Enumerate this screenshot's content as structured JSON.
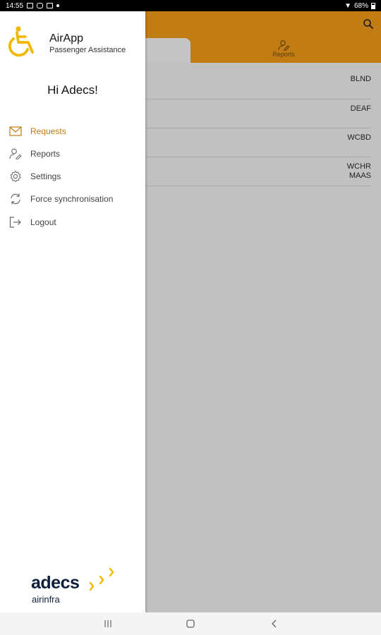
{
  "status_bar": {
    "time": "14:55",
    "battery": "68%"
  },
  "drawer": {
    "app_name": "AirApp",
    "app_subtitle": "Passenger Assistance",
    "greeting": "Hi Adecs!",
    "items": [
      {
        "label": "Requests",
        "icon": "mail-icon",
        "active": true
      },
      {
        "label": "Reports",
        "icon": "user-edit-icon",
        "active": false
      },
      {
        "label": "Settings",
        "icon": "gear-icon",
        "active": false
      },
      {
        "label": "Force synchronisation",
        "icon": "sync-icon",
        "active": false
      },
      {
        "label": "Logout",
        "icon": "logout-icon",
        "active": false
      }
    ],
    "brand": {
      "name": "adecs",
      "subtitle": "airinfra"
    }
  },
  "background": {
    "tabs": [
      {
        "label": "",
        "active": true
      },
      {
        "label": "Reports",
        "icon": "user-edit-icon",
        "active": false
      }
    ],
    "list_codes": [
      [
        "BLND"
      ],
      [
        "DEAF"
      ],
      [
        "WCBD"
      ],
      [
        "WCHR",
        "MAAS"
      ]
    ]
  },
  "colors": {
    "accent": "#c27c14",
    "scrim": "#c1c1c1",
    "brand_navy": "#0e1f3a",
    "brand_yellow": "#f2b800"
  }
}
